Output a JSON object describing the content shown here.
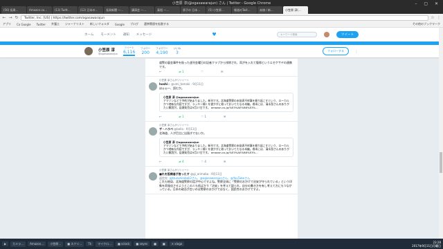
{
  "window": {
    "title": "小笠原 淳(@ogasawarajun) さん | Twitter - Google Chrome",
    "controls": "– ▢ ✕"
  },
  "tabs": [
    "(56) 長周…",
    "Amazon.co…",
    "(13) Twitt…",
    "(12) 日本の…",
    "長周新聞 —…",
    "講演会 —…",
    "真相 —…",
    "原子の 日本…",
    "(5) 小笠原…",
    "報道のTwit…",
    "赤旗 / 新…",
    "小笠原 淳(…"
  ],
  "address": {
    "url": "Twitter, Inc. [US] | https://twitter.com/ogasawarajun"
  },
  "nav_glyphs": {
    "back": "←",
    "forward": "→",
    "reload": "↻",
    "bookmark": "☆",
    "menu": "⋮"
  },
  "bookmarks": [
    "アプリ",
    "Co Google",
    "Twitter",
    "弁護士",
    "ジャーナリスト",
    "新しいフォルダ",
    "Google",
    "ブログ",
    "選挙関連を拡散する",
    "その他のブックマーク"
  ],
  "twitter_nav": {
    "home": "ホーム",
    "moments": "モーメント",
    "notifications": "通知",
    "messages": "メッセージ",
    "search_placeholder": "キーワード検索",
    "tweet_btn": "ツイート",
    "bird": "♥"
  },
  "profile": {
    "name": "小笠原 淳",
    "handle": "@ogasawarajun",
    "stats": [
      {
        "label": "ツイート",
        "value": "6,116"
      },
      {
        "label": "フォロー",
        "value": "200"
      },
      {
        "label": "フォロワー",
        "value": "4,190"
      },
      {
        "label": "いいね",
        "value": "3"
      }
    ],
    "follow_btn": "フォローする",
    "more": "⋮"
  },
  "tweets": [
    {
      "text": "道警の裏金事件を扱った週刊金曜日の記者クラブから排除され、両がを入れて復帰というエセケサヤの連携です。",
      "actions": [
        "↩",
        "⇄ 1",
        "♡",
        "✉"
      ]
    },
    {
      "rt": "小笠原 淳さんがリツイート",
      "name": "hoshi☆",
      "meta": "@umi_tamaki · 9月11日",
      "text": "ほぉぉ〜、読むか。",
      "card_name": "小笠原 淳 @ogasawarajun",
      "card_text": "アマゾンなどで予約が始まりました。新刊です。北海道警察の未発表不祥事を掘り起こすという、ローカルかつ地味な内容ですが、ラッキー開くを書かずに取っておいてたなる本編。巻末には、清水潔さんのありがたい解説が。店頭発売は9月27日です。 amazon.co.jp/%E5%AE%B6%E3%…",
      "actions": [
        "↩",
        "⇄ 1",
        "♡ 1",
        "✉"
      ]
    },
    {
      "rt": "小笠原 淳さんがリツイート",
      "name": "ザ・ハラペ",
      "meta": "@bella · 9月11日",
      "text": "北海道、人が目立に出過ぎでないか。",
      "card_name": "小笠原 淳 @ogasawarajun",
      "card_text": "アマゾンなどで予約が始まりました。新刊です。北海道警察の未発表不祥事を掘り起こすという、ローカルかつ地味な内容ですが、ラッキー開くを書かずに取っておいてたなる本編。巻末には、清水潔さんのありがたい解説が。店頭発売は9月27日です。 amazon.co.jp/%E5%AE%B6%E3%…",
      "actions": [
        "↩",
        "⇄ 4",
        "♡ 4",
        "✉"
      ]
    },
    {
      "rt": "小笠原 淳さんがリツイート",
      "name": "■れを投稿者が言ったす",
      "meta": "@gi_arimaba · 9月11日",
      "text_lead": "返信先:",
      "reply_to": "@tzuzuhirobali2さん、@ogasawarajunさん、@YouTubeさん",
      "text": "これも結局、北海道警察の話が中心ですよね。警察全体に「警察のおかげで治安が守られている」という印象を再強化させようとこの人も低ばかり「治安」を考えて語られ、自分の書き方を有し考えて方にもつながっている。日本の政治が言いのは警察のおかげではなく、国民性のおかげですよ。",
      "actions": []
    }
  ],
  "taskbar": {
    "items": [
      "▶",
      "カメラ…",
      "Amazon…",
      "小笠原…",
      "■ スクリ…",
      "Tk",
      "マイクロ…",
      "■ sclock",
      "■ xeyes",
      "■",
      "■",
      "✕ xlogo"
    ],
    "time": "23:28",
    "date": "2017年9月11日月曜日"
  }
}
